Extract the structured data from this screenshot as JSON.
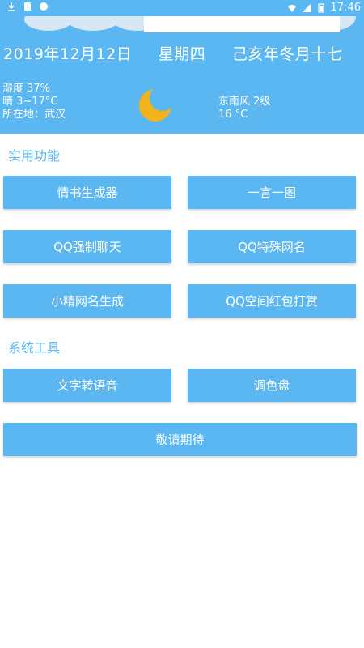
{
  "status_bar": {
    "time": "17:46",
    "left_icons": [
      "download-icon",
      "sdcard-icon",
      "app-notification-icon"
    ],
    "right_icons": [
      "wifi-icon",
      "signal-icon",
      "battery-icon"
    ]
  },
  "header": {
    "date_gregorian": "2019年12月12日",
    "weekday": "星期四",
    "date_lunar": "己亥年冬月十七",
    "humidity": "湿度 37%",
    "weather": "晴 3~17°C",
    "location": "所在地：武汉",
    "wind": "东南风 2级",
    "current_temp": "16 °C",
    "weather_icon": "moon-icon"
  },
  "sections": {
    "practical": {
      "title": "实用功能",
      "buttons": [
        "情书生成器",
        "一言一图",
        "QQ强制聊天",
        "QQ特殊网名",
        "小精网名生成",
        "QQ空间红包打赏"
      ]
    },
    "system": {
      "title": "系统工具",
      "buttons": [
        "文字转语音",
        "调色盘"
      ]
    }
  },
  "footer_button": "敬请期待",
  "colors": {
    "primary": "#5bb7f1",
    "text_on_primary": "#ffffff",
    "background": "#ffffff"
  }
}
